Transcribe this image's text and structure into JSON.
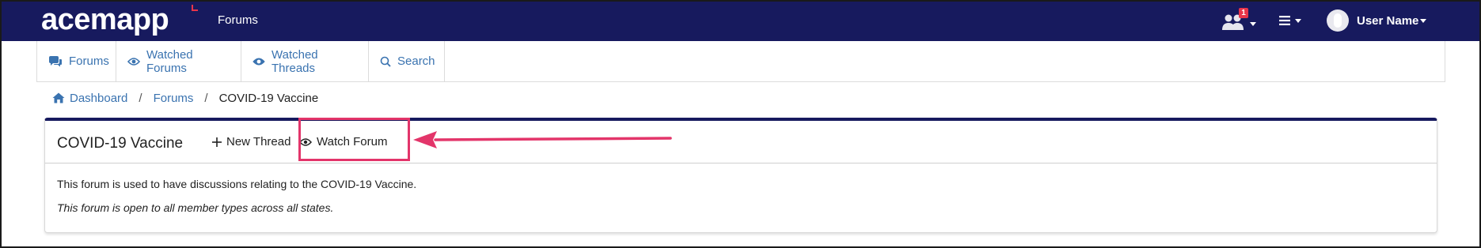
{
  "navbar": {
    "logo_text": "acemapp",
    "title": "Forums",
    "notification_count": "1",
    "user_name": "User Name",
    "background_color": "#171a5e"
  },
  "subnav": {
    "items": [
      {
        "label": "Forums",
        "icon": "forums-icon"
      },
      {
        "label": "Watched Forums",
        "icon": "eye-icon"
      },
      {
        "label": "Watched Threads",
        "icon": "eye-icon"
      },
      {
        "label": "Search",
        "icon": "search-icon"
      }
    ]
  },
  "breadcrumb": {
    "items": [
      {
        "label": "Dashboard",
        "icon": "home-icon"
      },
      {
        "label": "Forums"
      },
      {
        "label": "COVID-19 Vaccine"
      }
    ],
    "separator": "/"
  },
  "forum": {
    "title": "COVID-19 Vaccine",
    "new_thread_label": "New Thread",
    "watch_forum_label": "Watch Forum",
    "description": "This forum is used to have discussions relating to the COVID-19 Vaccine.",
    "access_note": "This forum is open to all member types across all states."
  },
  "colors": {
    "link": "#3a73b0",
    "highlight": "#e3356a",
    "accent_mark": "#e8354a"
  }
}
